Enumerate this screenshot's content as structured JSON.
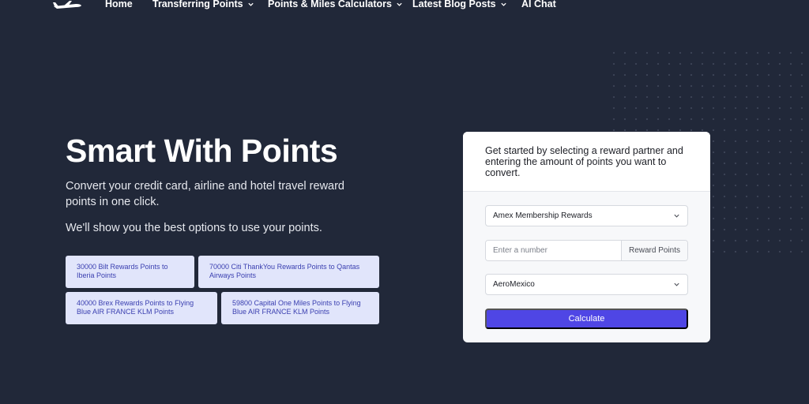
{
  "nav": {
    "items": [
      {
        "label": "Home",
        "dropdown": false
      },
      {
        "label": "Transferring Points",
        "dropdown": true
      },
      {
        "label": "Points & Miles Calculators",
        "dropdown": true
      },
      {
        "label": "Latest Blog Posts",
        "dropdown": true
      },
      {
        "label": "AI Chat",
        "dropdown": false
      }
    ]
  },
  "hero": {
    "title": "Smart With Points",
    "subtitle": "Convert your credit card, airline and hotel travel reward points in one click.",
    "subtitle2": "We'll show you the best options to use your points."
  },
  "quick_links": [
    "30000 Bilt Rewards Points to Iberia Points",
    "70000 Citi ThankYou Rewards Points to Qantas Airways Points",
    "40000 Brex Rewards Points to Flying Blue AIR FRANCE KLM Points",
    "59800 Capital One Miles Points to Flying Blue AIR FRANCE KLM Points"
  ],
  "calculator": {
    "intro": "Get started by selecting a reward partner and entering the amount of points you want to convert.",
    "from_program": "Amex Membership Rewards",
    "amount_placeholder": "Enter a number",
    "amount_addon": "Reward Points",
    "to_program": "AeroMexico",
    "button_label": "Calculate"
  },
  "colors": {
    "background": "#212839",
    "accent": "#4f46e5",
    "chip_bg": "#e1e5fb",
    "chip_text": "#3a3fb0"
  }
}
